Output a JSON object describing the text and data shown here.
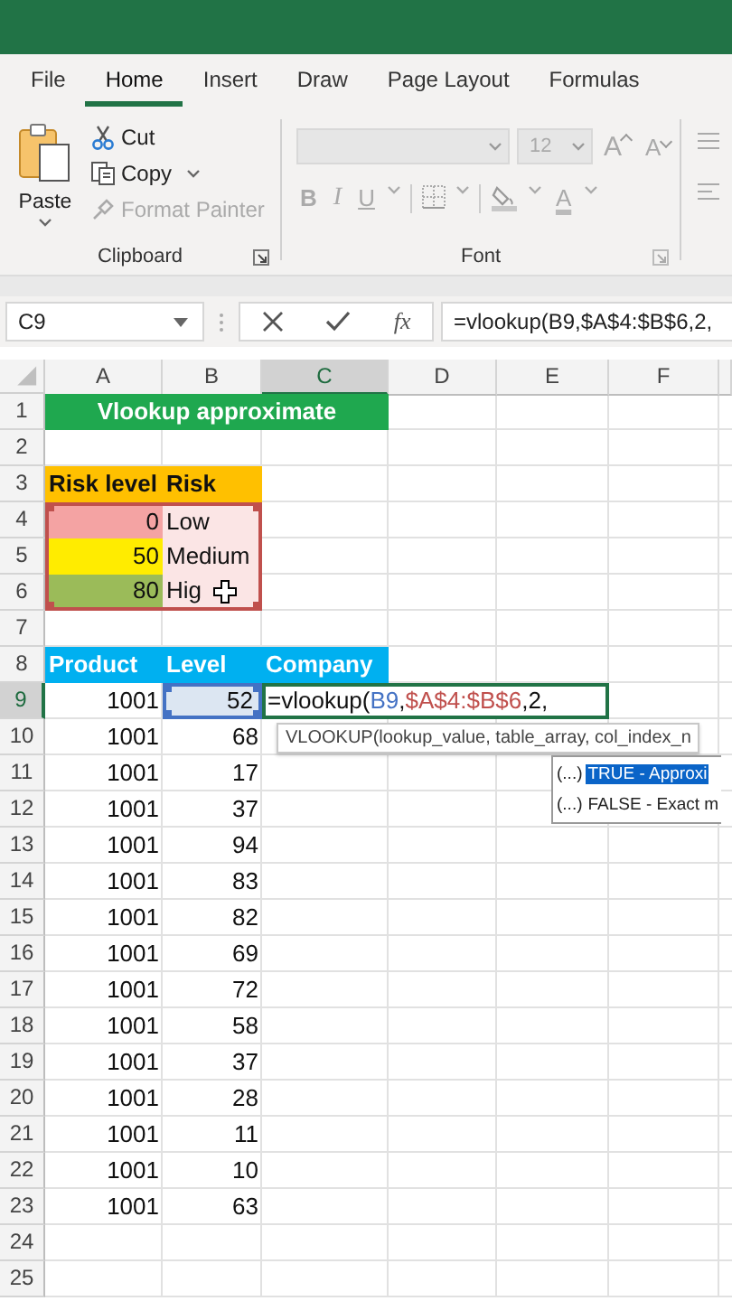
{
  "ribbon": {
    "tabs": [
      {
        "label": "File",
        "selected": false
      },
      {
        "label": "Home",
        "selected": true
      },
      {
        "label": "Insert",
        "selected": false
      },
      {
        "label": "Draw",
        "selected": false
      },
      {
        "label": "Page Layout",
        "selected": false
      },
      {
        "label": "Formulas",
        "selected": false
      }
    ],
    "clipboard": {
      "label": "Clipboard",
      "paste": "Paste",
      "cut": "Cut",
      "copy": "Copy",
      "format_painter": {
        "label": "Format Painter",
        "disabled": true
      }
    },
    "font": {
      "label": "Font",
      "disabled": true,
      "font_size": "12",
      "row_1": [
        {
          "kind": "grow",
          "label": "A"
        },
        {
          "kind": "shrink",
          "label": "A"
        }
      ],
      "row_2": [
        {
          "kind": "bold",
          "label": "B"
        },
        {
          "kind": "italic",
          "label": "I"
        },
        {
          "kind": "underline",
          "label": "U"
        },
        {
          "kind": "borders"
        },
        {
          "kind": "fill"
        },
        {
          "kind": "font_color",
          "label": "A"
        }
      ]
    }
  },
  "formula_bar": {
    "name_box": "C9",
    "fx": "fx",
    "formula": "=vlookup(B9,$A$4:$B$6,2,"
  },
  "sheet": {
    "columns": [
      {
        "label": "A",
        "selected": false
      },
      {
        "label": "B",
        "selected": false
      },
      {
        "label": "C",
        "selected": true
      },
      {
        "label": "D",
        "selected": false
      },
      {
        "label": "E",
        "selected": false
      },
      {
        "label": "F",
        "selected": false
      }
    ],
    "rows": [
      {
        "number": "1",
        "selected": false,
        "cells": [
          {
            "kind": "title",
            "text": "Vlookup approximate",
            "color": "#1fa84f"
          }
        ]
      },
      {
        "number": "2",
        "selected": false
      },
      {
        "number": "3",
        "selected": false,
        "cells": [
          {
            "kind": "header",
            "text": "Risk level",
            "color": "#ffc000"
          },
          {
            "kind": "header",
            "text": "Risk",
            "color": "#ffc000"
          }
        ]
      },
      {
        "number": "4",
        "selected": false,
        "cells": [
          {
            "kind": "number",
            "text": "0",
            "color": "#f4a3a3",
            "reference": {
              "color": "#c0504d"
            }
          },
          {
            "kind": "text",
            "text": "Low",
            "color": "#fbe5e5",
            "reference": {
              "color": "#c0504d"
            }
          }
        ]
      },
      {
        "number": "5",
        "selected": false,
        "cells": [
          {
            "kind": "number",
            "text": "50",
            "color": "#ffec00",
            "reference": {
              "color": "#c0504d"
            }
          },
          {
            "kind": "text",
            "text": "Medium",
            "color": "#fbe5e5",
            "reference": {
              "color": "#c0504d"
            }
          }
        ]
      },
      {
        "number": "6",
        "selected": false,
        "cells": [
          {
            "kind": "number",
            "text": "80",
            "color": "#9bbb59",
            "reference": {
              "color": "#c0504d"
            }
          },
          {
            "kind": "text",
            "text": "Hig",
            "color": "#fbe5e5",
            "cursor_visible": true,
            "reference": {
              "color": "#c0504d"
            }
          }
        ]
      },
      {
        "number": "7",
        "selected": false
      },
      {
        "number": "8",
        "selected": false,
        "cells": [
          {
            "kind": "header",
            "text": "Product",
            "color": "#00b0f0"
          },
          {
            "kind": "header",
            "text": "Level",
            "color": "#00b0f0"
          },
          {
            "kind": "header",
            "text": "Company",
            "color": "#00b0f0"
          }
        ]
      },
      {
        "number": "9",
        "selected": true,
        "cells": [
          {
            "kind": "number",
            "text": "1001"
          },
          {
            "kind": "number",
            "text": "52",
            "color": "#dce6f2",
            "reference": {
              "color": "#4472c4"
            }
          },
          {
            "kind": "formula",
            "references": [
              {
                "before": "=vlookup(",
                "text": "B9",
                "color": "#4472c4"
              },
              {
                "before": ",",
                "text": "$A$4:$B$6",
                "color": "#c0504d"
              }
            ],
            "after": ",2,",
            "tooltip": "VLOOKUP(lookup_value, table_array, col_index_n",
            "suggestions": [
              {
                "marker": "(...)",
                "label": "TRUE - Approxi",
                "selected": true
              },
              {
                "marker": "(...)",
                "label": "FALSE - Exact m",
                "selected": false
              }
            ]
          }
        ]
      },
      {
        "number": "10",
        "selected": false,
        "cells": [
          {
            "kind": "number",
            "text": "1001"
          },
          {
            "kind": "number",
            "text": "68"
          }
        ]
      },
      {
        "number": "11",
        "selected": false,
        "cells": [
          {
            "kind": "number",
            "text": "1001"
          },
          {
            "kind": "number",
            "text": "17"
          }
        ]
      },
      {
        "number": "12",
        "selected": false,
        "cells": [
          {
            "kind": "number",
            "text": "1001"
          },
          {
            "kind": "number",
            "text": "37"
          }
        ]
      },
      {
        "number": "13",
        "selected": false,
        "cells": [
          {
            "kind": "number",
            "text": "1001"
          },
          {
            "kind": "number",
            "text": "94"
          }
        ]
      },
      {
        "number": "14",
        "selected": false,
        "cells": [
          {
            "kind": "number",
            "text": "1001"
          },
          {
            "kind": "number",
            "text": "83"
          }
        ]
      },
      {
        "number": "15",
        "selected": false,
        "cells": [
          {
            "kind": "number",
            "text": "1001"
          },
          {
            "kind": "number",
            "text": "82"
          }
        ]
      },
      {
        "number": "16",
        "selected": false,
        "cells": [
          {
            "kind": "number",
            "text": "1001"
          },
          {
            "kind": "number",
            "text": "69"
          }
        ]
      },
      {
        "number": "17",
        "selected": false,
        "cells": [
          {
            "kind": "number",
            "text": "1001"
          },
          {
            "kind": "number",
            "text": "72"
          }
        ]
      },
      {
        "number": "18",
        "selected": false,
        "cells": [
          {
            "kind": "number",
            "text": "1001"
          },
          {
            "kind": "number",
            "text": "58"
          }
        ]
      },
      {
        "number": "19",
        "selected": false,
        "cells": [
          {
            "kind": "number",
            "text": "1001"
          },
          {
            "kind": "number",
            "text": "37"
          }
        ]
      },
      {
        "number": "20",
        "selected": false,
        "cells": [
          {
            "kind": "number",
            "text": "1001"
          },
          {
            "kind": "number",
            "text": "28"
          }
        ]
      },
      {
        "number": "21",
        "selected": false,
        "cells": [
          {
            "kind": "number",
            "text": "1001"
          },
          {
            "kind": "number",
            "text": "11"
          }
        ]
      },
      {
        "number": "22",
        "selected": false,
        "cells": [
          {
            "kind": "number",
            "text": "1001"
          },
          {
            "kind": "number",
            "text": "10"
          }
        ]
      },
      {
        "number": "23",
        "selected": false,
        "cells": [
          {
            "kind": "number",
            "text": "1001"
          },
          {
            "kind": "number",
            "text": "63"
          }
        ]
      },
      {
        "number": "24",
        "selected": false
      },
      {
        "number": "25",
        "selected": false
      }
    ]
  }
}
